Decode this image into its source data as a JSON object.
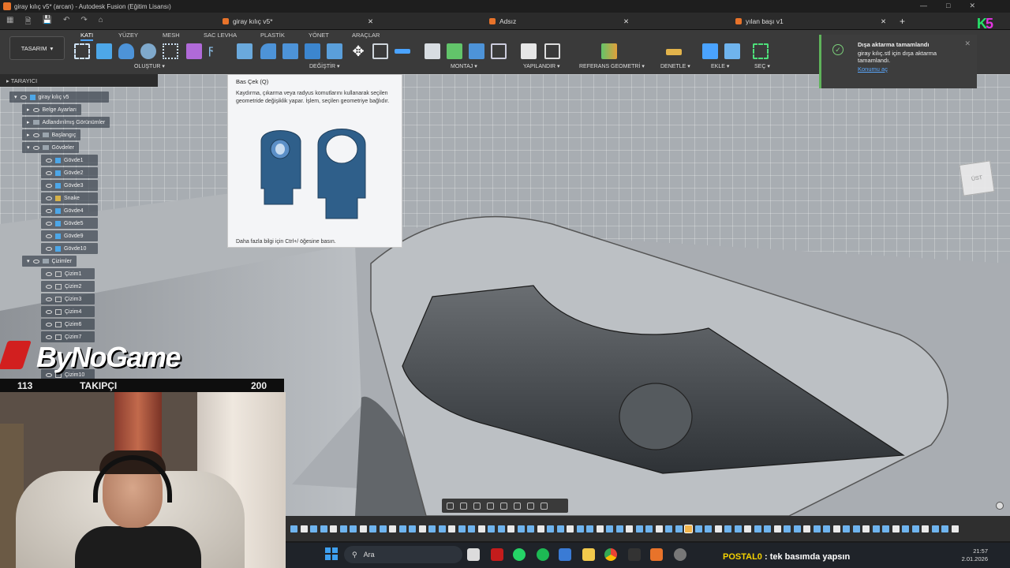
{
  "window": {
    "title": "giray kılıç v5* (arcan) - Autodesk Fusion (Eğitim Lisansı)"
  },
  "tabs": [
    {
      "label": "giray kılıç v5*"
    },
    {
      "label": "Adsız"
    },
    {
      "label": "yılan başı v1"
    }
  ],
  "corner_badge": {
    "letter": "K",
    "number": "5"
  },
  "ribbon": {
    "workspace": "TASARIM",
    "tabs": [
      "KATI",
      "YÜZEY",
      "MESH",
      "SAC LEVHA",
      "PLASTİK",
      "YÖNET",
      "ARAÇLAR"
    ],
    "active_tab": "KATI",
    "groups": [
      "OLUŞTUR",
      "DEĞİŞTİR",
      "MONTAJ",
      "YAPILANDIR",
      "REFERANS GEOMETRİ",
      "DENETLE",
      "EKLE",
      "SEÇ"
    ]
  },
  "browser": {
    "header": "TARAYICI",
    "root": "giray kılıç v5",
    "nodes": [
      "Belge Ayarları",
      "Adlandırılmış Görünümler",
      "Başlangıç",
      "Gövdeler",
      "Gövde1",
      "Gövde2",
      "Gövde3",
      "Snake",
      "Gövde4",
      "Gövde5",
      "Gövde9",
      "Gövde10",
      "Çizimler",
      "Çizim1",
      "Çizim2",
      "Çizim3",
      "Çizim4",
      "Çizim6",
      "Çizim7",
      "Çizim10"
    ]
  },
  "tooltip": {
    "title": "Bas Çek (Q)",
    "body": "Kaydırma, çıkarma veya radyus komutlarını kullanarak seçilen geometride değişiklik yapar. İşlem, seçilen geometriye bağlıdır.",
    "footer": "Daha fazla bilgi için Ctrl+/ öğesine basın."
  },
  "notification": {
    "title": "Dışa aktarma tamamlandı",
    "message": "giray kılıç.stl için dışa aktarma tamamlandı.",
    "link": "Konumu aç"
  },
  "overlay": {
    "brand": "ByNoGame",
    "follower_current": "113",
    "follower_label": "TAKIPÇI",
    "follower_goal": "200"
  },
  "taskbar": {
    "search_placeholder": "Ara",
    "ticker_name": "POSTAL0",
    "ticker_text": " : tek basımda yapsın",
    "time": "21:57",
    "date": "2.01.2026"
  },
  "colors": {
    "accent": "#4aa3ff",
    "brand_orange": "#e8732a",
    "success": "#5fb35a",
    "body_blue": "#4da7e8"
  }
}
